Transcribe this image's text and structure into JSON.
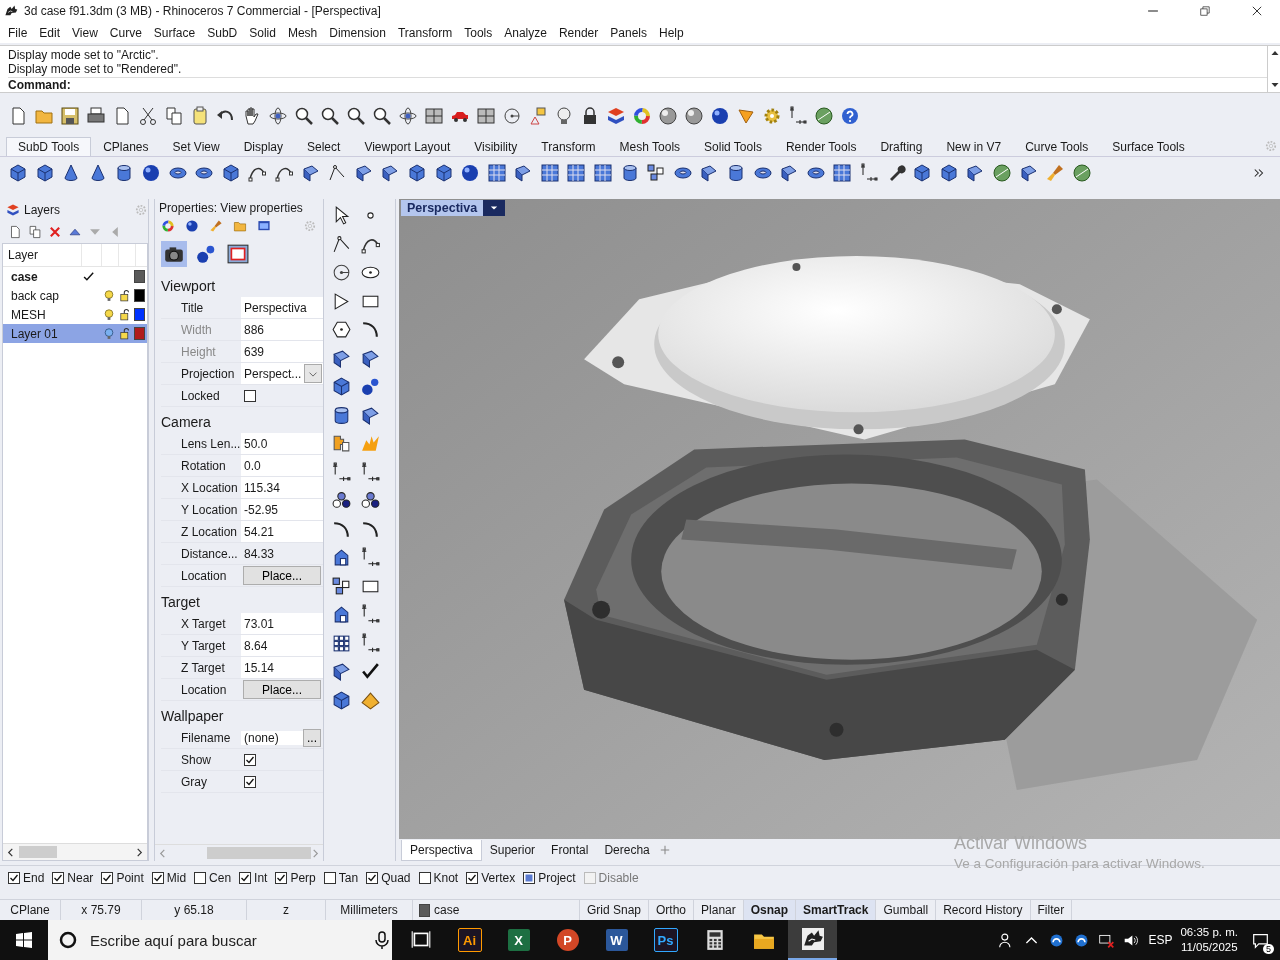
{
  "window": {
    "title": "3d case f91.3dm (3 MB) - Rhinoceros 7 Commercial - [Perspectiva]"
  },
  "menu": [
    "File",
    "Edit",
    "View",
    "Curve",
    "Surface",
    "SubD",
    "Solid",
    "Mesh",
    "Dimension",
    "Transform",
    "Tools",
    "Analyze",
    "Render",
    "Panels",
    "Help"
  ],
  "command": {
    "history": [
      "Display mode set to \"Arctic\".",
      "Display mode set to \"Rendered\"."
    ],
    "prompt": "Command:"
  },
  "toolbar_tabs": [
    {
      "label": "SubD Tools",
      "selected": true
    },
    {
      "label": "CPlanes",
      "selected": false
    },
    {
      "label": "Set View",
      "selected": false
    },
    {
      "label": "Display",
      "selected": false
    },
    {
      "label": "Select",
      "selected": false
    },
    {
      "label": "Viewport Layout",
      "selected": false
    },
    {
      "label": "Visibility",
      "selected": false
    },
    {
      "label": "Transform",
      "selected": false
    },
    {
      "label": "Mesh Tools",
      "selected": false
    },
    {
      "label": "Solid Tools",
      "selected": false
    },
    {
      "label": "Render Tools",
      "selected": false
    },
    {
      "label": "Drafting",
      "selected": false
    },
    {
      "label": "New in V7",
      "selected": false
    },
    {
      "label": "Curve Tools",
      "selected": false
    },
    {
      "label": "Surface Tools",
      "selected": false
    }
  ],
  "layers": {
    "title": "Layers",
    "column": "Layer",
    "rows": [
      {
        "name": "case",
        "current": true,
        "selected": false,
        "color": "#5a5a5a"
      },
      {
        "name": "back cap",
        "current": false,
        "selected": false,
        "color": "#000000"
      },
      {
        "name": "MESH",
        "current": false,
        "selected": false,
        "color": "#0033ff"
      },
      {
        "name": "Layer 01",
        "current": false,
        "selected": true,
        "color": "#b01c1c"
      }
    ]
  },
  "properties": {
    "title": "Properties: View properties",
    "sections": [
      {
        "title": "Viewport",
        "fields": [
          {
            "label": "Title",
            "value": "Perspectiva",
            "kind": "text",
            "disabled": false
          },
          {
            "label": "Width",
            "value": "886",
            "kind": "text",
            "disabled": true
          },
          {
            "label": "Height",
            "value": "639",
            "kind": "text",
            "disabled": true
          },
          {
            "label": "Projection",
            "value": "Perspect...",
            "kind": "dropdown",
            "disabled": false
          },
          {
            "label": "Locked",
            "kind": "checkbox",
            "checked": false,
            "disabled": false
          }
        ]
      },
      {
        "title": "Camera",
        "fields": [
          {
            "label": "Lens Len...",
            "value": "50.0",
            "kind": "text",
            "disabled": false
          },
          {
            "label": "Rotation",
            "value": "0.0",
            "kind": "text",
            "disabled": false
          },
          {
            "label": "X Location",
            "value": "115.34",
            "kind": "text",
            "disabled": false
          },
          {
            "label": "Y Location",
            "value": "-52.95",
            "kind": "text",
            "disabled": false
          },
          {
            "label": "Z Location",
            "value": "54.21",
            "kind": "text",
            "disabled": false
          },
          {
            "label": "Distance...",
            "value": "84.33",
            "kind": "readonly",
            "disabled": false
          },
          {
            "label": "Location",
            "value": "Place...",
            "kind": "button",
            "disabled": false
          }
        ]
      },
      {
        "title": "Target",
        "fields": [
          {
            "label": "X Target",
            "value": "73.01",
            "kind": "text",
            "disabled": false
          },
          {
            "label": "Y Target",
            "value": "8.64",
            "kind": "text",
            "disabled": false
          },
          {
            "label": "Z Target",
            "value": "15.14",
            "kind": "text",
            "disabled": false
          },
          {
            "label": "Location",
            "value": "Place...",
            "kind": "button",
            "disabled": false
          }
        ]
      },
      {
        "title": "Wallpaper",
        "fields": [
          {
            "label": "Filename",
            "value": "(none)",
            "button": "...",
            "kind": "file",
            "disabled": false
          },
          {
            "label": "Show",
            "kind": "checkbox",
            "checked": true,
            "disabled": false
          },
          {
            "label": "Gray",
            "kind": "checkbox",
            "checked": true,
            "disabled": false
          }
        ]
      }
    ]
  },
  "viewport": {
    "title": "Perspectiva",
    "tabs": [
      {
        "label": "Perspectiva",
        "selected": true
      },
      {
        "label": "Superior",
        "selected": false
      },
      {
        "label": "Frontal",
        "selected": false
      },
      {
        "label": "Derecha",
        "selected": false
      }
    ]
  },
  "osnaps": [
    {
      "label": "End",
      "checked": true,
      "kind": "osnap"
    },
    {
      "label": "Near",
      "checked": true,
      "kind": "osnap"
    },
    {
      "label": "Point",
      "checked": true,
      "kind": "osnap"
    },
    {
      "label": "Mid",
      "checked": true,
      "kind": "osnap"
    },
    {
      "label": "Cen",
      "checked": false,
      "kind": "osnap"
    },
    {
      "label": "Int",
      "checked": true,
      "kind": "osnap"
    },
    {
      "label": "Perp",
      "checked": true,
      "kind": "osnap"
    },
    {
      "label": "Tan",
      "checked": false,
      "kind": "osnap"
    },
    {
      "label": "Quad",
      "checked": true,
      "kind": "osnap"
    },
    {
      "label": "Knot",
      "checked": false,
      "kind": "osnap"
    },
    {
      "label": "Vertex",
      "checked": true,
      "kind": "osnap"
    },
    {
      "label": "Project",
      "checked": true,
      "kind": "mode"
    },
    {
      "label": "Disable",
      "checked": false,
      "kind": "greyed"
    }
  ],
  "status_bar": {
    "cells": [
      "CPlane",
      "x 75.79",
      "y 65.18",
      "z",
      "Millimeters"
    ],
    "layer": {
      "name": "case",
      "color": "#5a5a5a"
    },
    "toggles": [
      {
        "label": "Grid Snap",
        "on": false
      },
      {
        "label": "Ortho",
        "on": false
      },
      {
        "label": "Planar",
        "on": false
      },
      {
        "label": "Osnap",
        "on": true
      },
      {
        "label": "SmartTrack",
        "on": true
      },
      {
        "label": "Gumball",
        "on": false
      },
      {
        "label": "Record History",
        "on": false
      },
      {
        "label": "Filter",
        "on": false
      }
    ]
  },
  "activation": {
    "title": "Activar Windows",
    "message": "Ve a Configuración para activar Windows."
  },
  "taskbar": {
    "search_placeholder": "Escribe aquí para buscar",
    "apps": [
      {
        "kind": "taskview",
        "selected": false
      },
      {
        "kind": "dark-tile",
        "label": "Ai",
        "color": "#ff9a00",
        "selected": false
      },
      {
        "kind": "solid-tile",
        "label": "X",
        "color": "#1d6f42",
        "selected": false
      },
      {
        "kind": "round-tile",
        "label": "P",
        "color": "#d24726",
        "selected": false
      },
      {
        "kind": "solid-tile",
        "label": "W",
        "color": "#2b579a",
        "selected": false
      },
      {
        "kind": "dark-tile",
        "label": "Ps",
        "color": "#31a8ff",
        "selected": false
      },
      {
        "kind": "calculator",
        "selected": false
      },
      {
        "kind": "folder",
        "selected": false
      },
      {
        "kind": "rhino",
        "selected": true
      }
    ],
    "language": "ESP",
    "time": "06:35 p. m.",
    "date": "11/05/2025",
    "notifications": "5"
  }
}
